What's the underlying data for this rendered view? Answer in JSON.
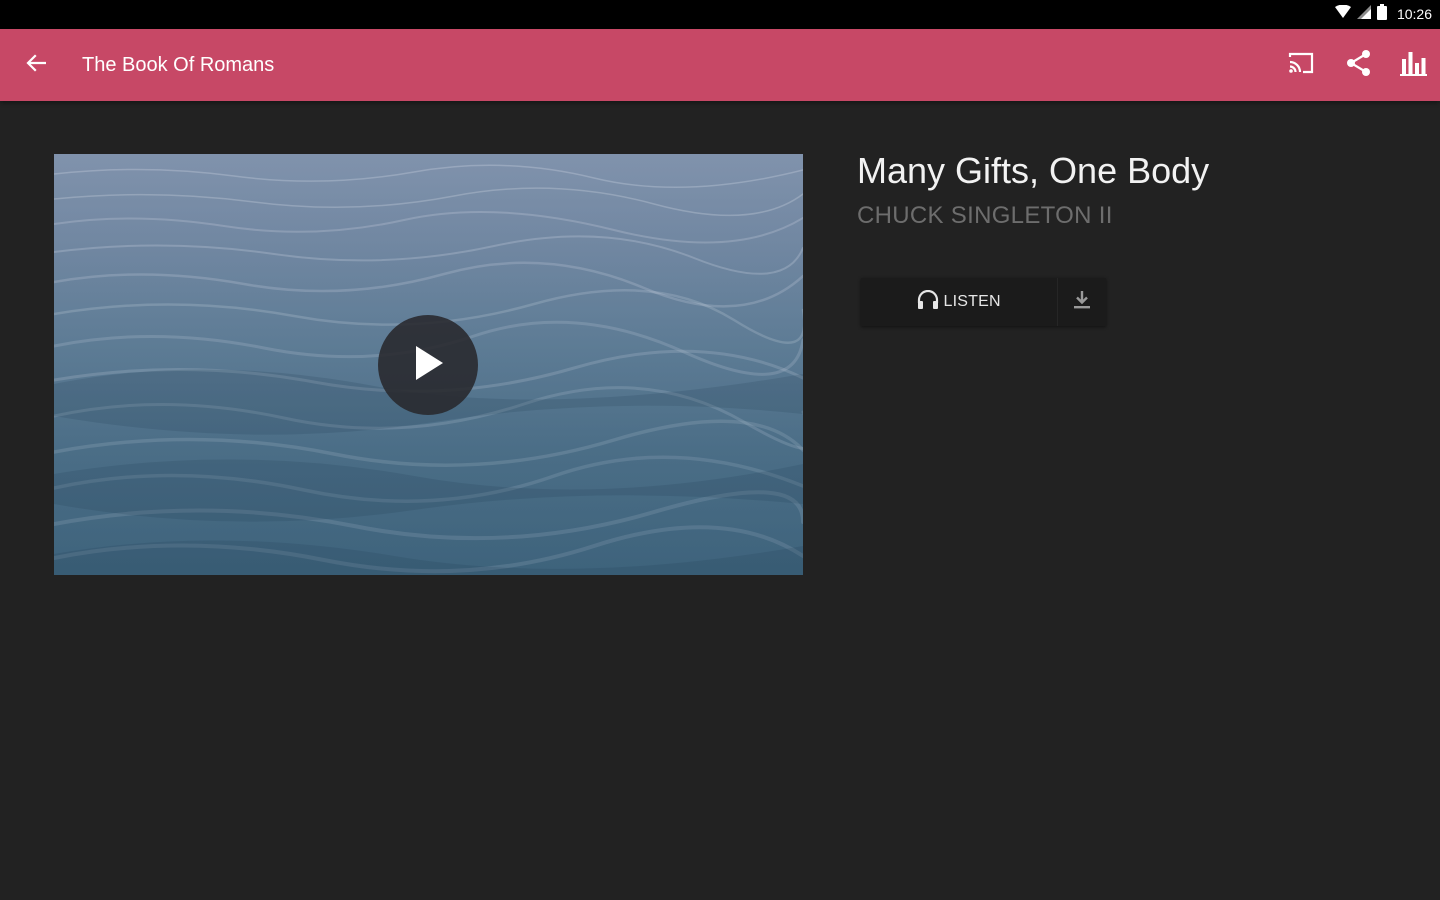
{
  "status_bar": {
    "time": "10:26",
    "icons": [
      "wifi-icon",
      "cell-signal-icon",
      "battery-icon"
    ]
  },
  "app_bar": {
    "title": "The Book Of Romans",
    "background_color": "#c74866",
    "icons": [
      "back-arrow-icon",
      "cast-icon",
      "share-icon",
      "bar-chart-icon"
    ]
  },
  "video": {
    "icon": "play-icon"
  },
  "message": {
    "title": "Many Gifts, One Body",
    "speaker": "CHUCK SINGLETON II",
    "listen_label": "LISTEN",
    "icons": [
      "headphones-icon",
      "download-icon"
    ]
  }
}
